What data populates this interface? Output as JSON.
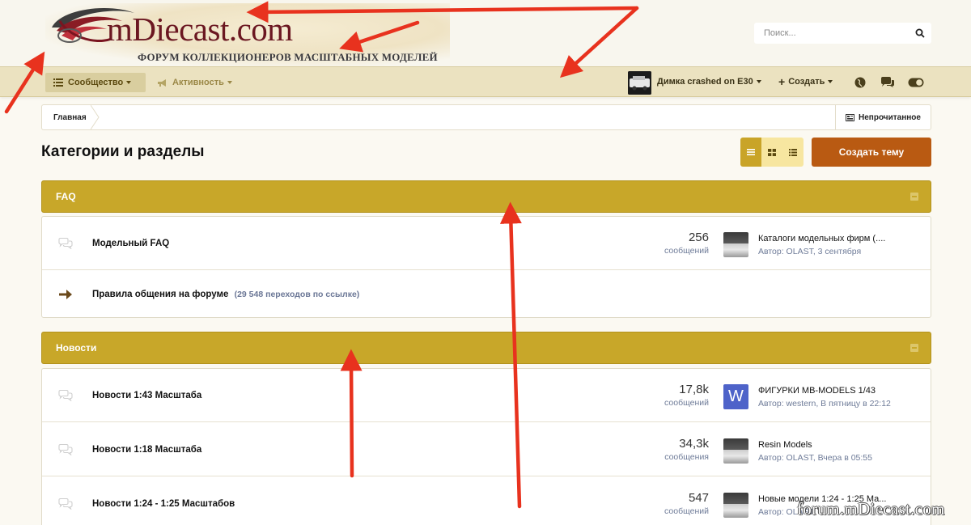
{
  "header": {
    "logo_title": "mDiecast.com",
    "logo_subtitle": "ФОРУМ КОЛЛЕКЦИОНЕРОВ МАСШТАБНЫХ МОДЕЛЕЙ",
    "search_placeholder": "Поиск..."
  },
  "nav": {
    "community_label": "Сообщество",
    "activity_label": "Активность",
    "user_label": "Димка crashed on E30",
    "create_label": "Создать"
  },
  "breadcrumb": {
    "home_label": "Главная",
    "unread_label": "Непрочитанное"
  },
  "page": {
    "title": "Категории и разделы",
    "create_topic_label": "Создать тему"
  },
  "categories": [
    {
      "title": "FAQ",
      "forums": [
        {
          "title": "Модельный FAQ",
          "stat_num": "256",
          "stat_label": "сообщений",
          "last_post_title": "Каталоги модельных фирм (....",
          "last_post_meta": "Автор: OLAST, 3 сентября"
        },
        {
          "title": "Правила общения на форуме",
          "redirect_note": "(29 548 переходов по ссылке)"
        }
      ]
    },
    {
      "title": "Новости",
      "forums": [
        {
          "title": "Новости 1:43 Масштаба",
          "stat_num": "17,8k",
          "stat_label": "сообщений",
          "last_post_avatar_letter": "W",
          "last_post_title": "ФИГУРКИ MB-MODELS 1/43",
          "last_post_meta": "Автор: western, В пятницу в 22:12"
        },
        {
          "title": "Новости 1:18 Масштаба",
          "stat_num": "34,3k",
          "stat_label": "сообщения",
          "last_post_title": "Resin Models",
          "last_post_meta": "Автор: OLAST, Вчера в 05:55"
        },
        {
          "title": "Новости 1:24 - 1:25 Масштабов",
          "stat_num": "547",
          "stat_label": "сообщений",
          "last_post_title": "Новые модели 1:24 - 1:25 Ма...",
          "last_post_meta": "Автор: OLAST,"
        }
      ]
    }
  ],
  "watermark": "forum.mDiecast.com",
  "colors": {
    "category_header": "#c8a729",
    "create_button": "#b95a12",
    "navbar": "#ebe2c0",
    "annotation_arrow": "#e8321e",
    "muted_text": "#6e7b98"
  }
}
